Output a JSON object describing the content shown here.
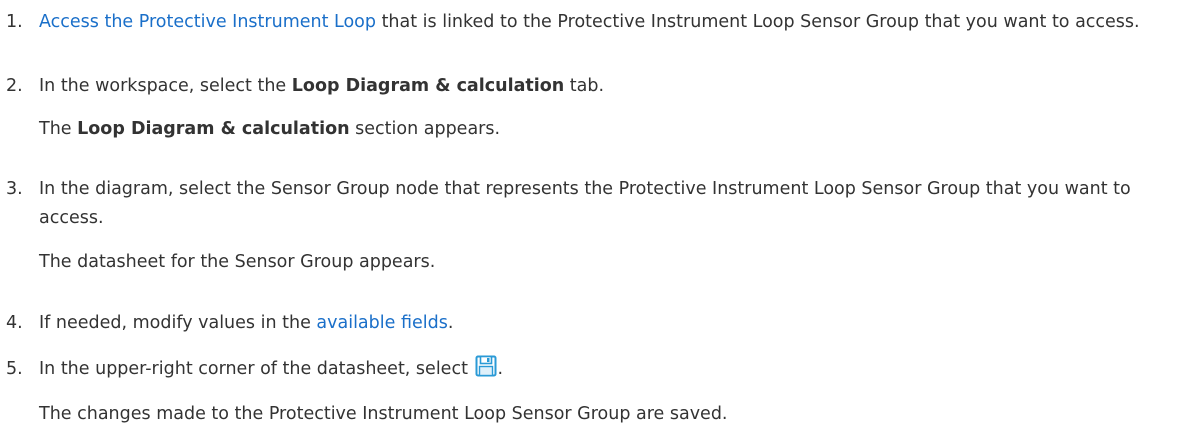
{
  "steps": [
    {
      "number": "1.",
      "link_text": "Access the Protective Instrument Loop",
      "text_after": " that is linked to the Protective Instrument Loop Sensor Group that you want to access."
    },
    {
      "number": "2.",
      "text_before": "In the workspace, select the ",
      "bold": "Loop Diagram & calculation",
      "text_after": " tab.",
      "result_bold": "Loop Diagram & calculation",
      "result_after": " section appears.",
      "result_before": "The "
    },
    {
      "number": "3.",
      "text": "In the diagram, select the Sensor Group node that represents the Protective Instrument Loop Sensor Group that you want to access.",
      "result": "The datasheet for the Sensor Group appears."
    },
    {
      "number": "4.",
      "text_before": "If needed, modify values in the ",
      "link_text": "available fields",
      "text_after": "."
    },
    {
      "number": "5.",
      "text_before": "In the upper-right corner of the datasheet, select ",
      "icon": "save-icon",
      "text_after": ".",
      "result": "The changes made to the Protective Instrument Loop Sensor Group are saved."
    }
  ],
  "colors": {
    "text": "#333333",
    "link": "#1a6fc9",
    "icon": "#2a9ad6"
  }
}
